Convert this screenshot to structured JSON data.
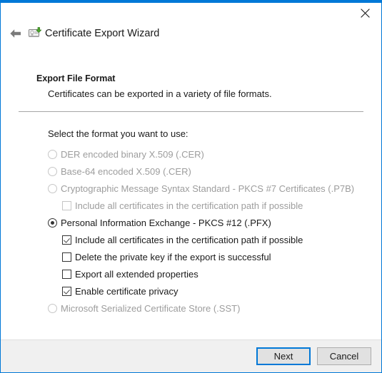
{
  "window": {
    "title": "Certificate Export Wizard",
    "title_icon": "certificate-export-icon",
    "back_icon": "back-arrow-icon",
    "close_icon": "close-icon",
    "accent_color": "#0078d7"
  },
  "header": {
    "title": "Export File Format",
    "subtitle": "Certificates can be exported in a variety of file formats."
  },
  "body": {
    "prompt": "Select the format you want to use:",
    "options": [
      {
        "label": "DER encoded binary X.509 (.CER)",
        "control": "radio",
        "checked": false,
        "disabled": true,
        "indent": 0,
        "name": "der-encoded-binary-option"
      },
      {
        "label": "Base-64 encoded X.509 (.CER)",
        "control": "radio",
        "checked": false,
        "disabled": true,
        "indent": 0,
        "name": "base64-encoded-option"
      },
      {
        "label": "Cryptographic Message Syntax Standard - PKCS #7 Certificates (.P7B)",
        "control": "radio",
        "checked": false,
        "disabled": true,
        "indent": 0,
        "name": "pkcs7-option"
      },
      {
        "label": "Include all certificates in the certification path if possible",
        "control": "checkbox",
        "checked": false,
        "disabled": true,
        "indent": 1,
        "name": "pkcs7-include-all-certificates-checkbox"
      },
      {
        "label": "Personal Information Exchange - PKCS #12 (.PFX)",
        "control": "radio",
        "checked": true,
        "disabled": false,
        "indent": 0,
        "name": "pkcs12-pfx-option"
      },
      {
        "label": "Include all certificates in the certification path if possible",
        "control": "checkbox",
        "checked": true,
        "disabled": false,
        "indent": 1,
        "name": "pfx-include-all-certificates-checkbox"
      },
      {
        "label": "Delete the private key if the export is successful",
        "control": "checkbox",
        "checked": false,
        "disabled": false,
        "indent": 1,
        "name": "delete-private-key-checkbox"
      },
      {
        "label": "Export all extended properties",
        "control": "checkbox",
        "checked": false,
        "disabled": false,
        "indent": 1,
        "name": "export-extended-properties-checkbox"
      },
      {
        "label": "Enable certificate privacy",
        "control": "checkbox",
        "checked": true,
        "disabled": false,
        "indent": 1,
        "name": "enable-certificate-privacy-checkbox"
      },
      {
        "label": "Microsoft Serialized Certificate Store (.SST)",
        "control": "radio",
        "checked": false,
        "disabled": true,
        "indent": 0,
        "name": "serialized-certificate-store-option"
      }
    ]
  },
  "footer": {
    "next_label": "Next",
    "cancel_label": "Cancel"
  }
}
